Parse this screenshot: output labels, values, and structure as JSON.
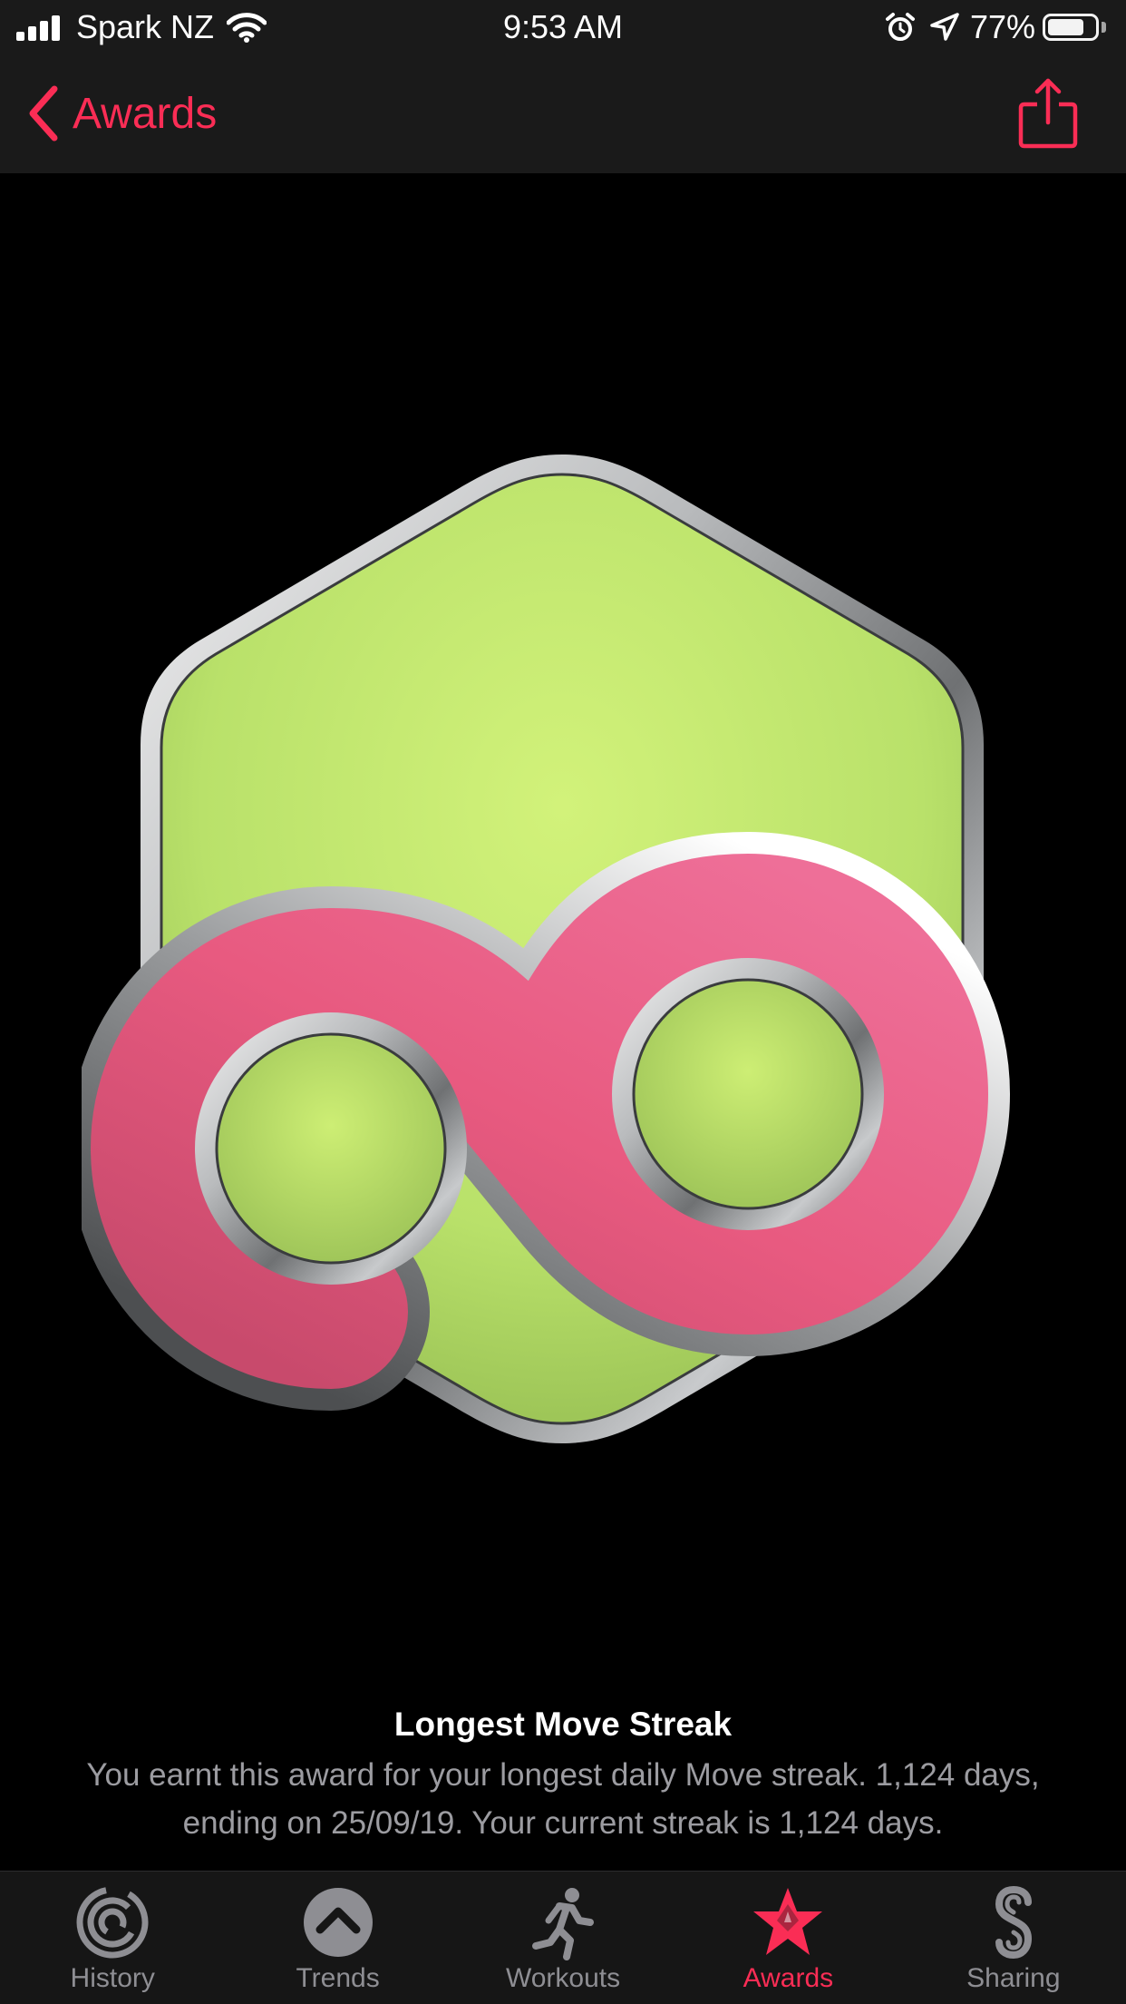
{
  "status_bar": {
    "carrier": "Spark NZ",
    "time": "9:53 AM",
    "battery_percent": "77%",
    "battery_level": 0.77,
    "icons": [
      "signal-bars-icon",
      "wifi-icon",
      "alarm-icon",
      "location-arrow-icon",
      "battery-icon"
    ]
  },
  "nav": {
    "back_label": "Awards",
    "back_icon": "chevron-left-icon",
    "share_icon": "share-icon"
  },
  "award": {
    "title": "Longest Move Streak",
    "description": "You earnt this award for your longest daily Move streak. 1,124 days, ending on 25/09/19. Your current streak is 1,124 days.",
    "medal_icon": "infinity-hexagon-medal-icon"
  },
  "tabs": [
    {
      "label": "History",
      "icon": "history-rings-icon",
      "active": false
    },
    {
      "label": "Trends",
      "icon": "trends-chevron-up-icon",
      "active": false
    },
    {
      "label": "Workouts",
      "icon": "running-figure-icon",
      "active": false
    },
    {
      "label": "Awards",
      "icon": "star-award-icon",
      "active": true
    },
    {
      "label": "Sharing",
      "icon": "sharing-s-icon",
      "active": false
    }
  ],
  "colors": {
    "accent": "#fa2d55",
    "medal_green": "#c5ec6a",
    "medal_pink": "#ea5a80",
    "bar_background": "#1a1a1a",
    "inactive_text": "#8e8e93"
  }
}
